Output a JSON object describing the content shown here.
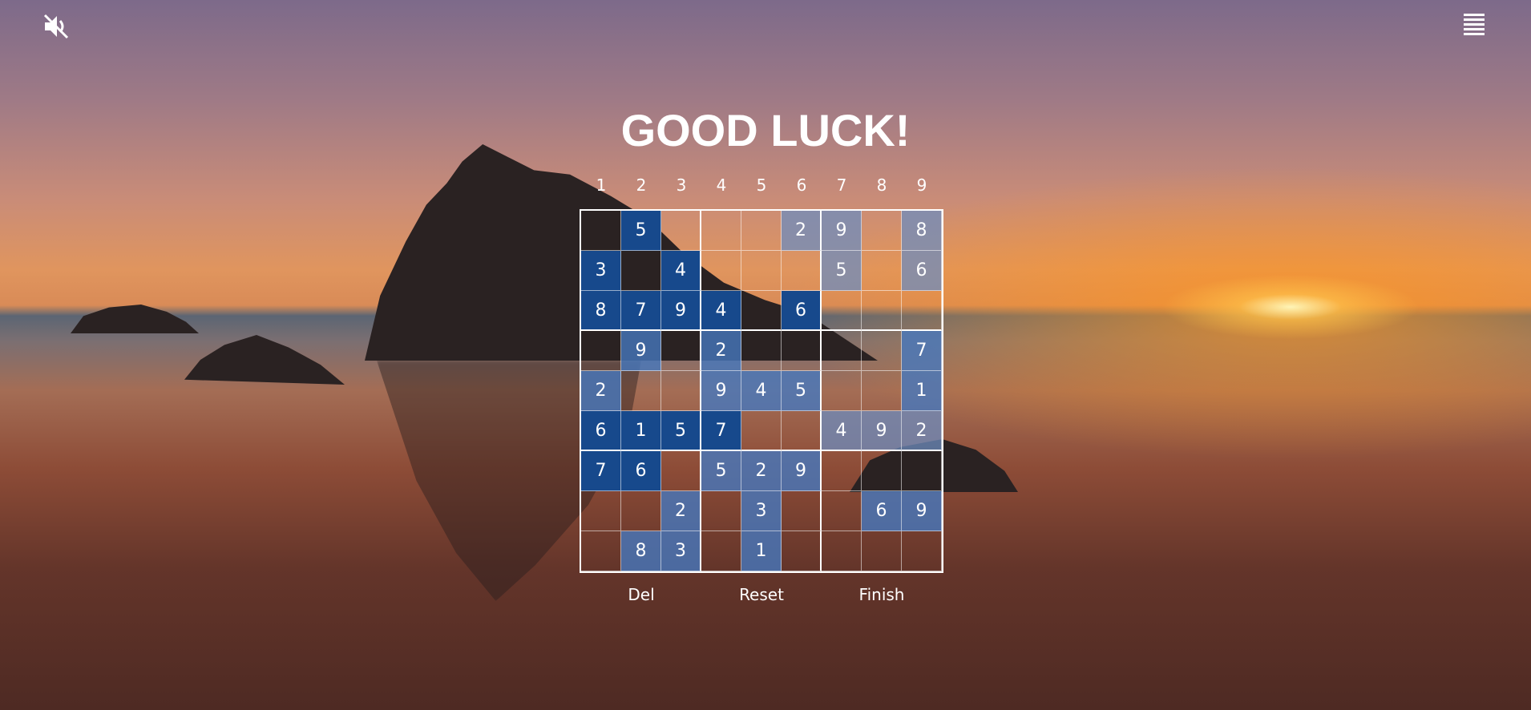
{
  "title": "GOOD LUCK!",
  "icons": {
    "mute": "mute-icon",
    "menu": "menu-icon"
  },
  "columns": [
    "1",
    "2",
    "3",
    "4",
    "5",
    "6",
    "7",
    "8",
    "9"
  ],
  "board": [
    [
      {
        "v": "",
        "t": "empty"
      },
      {
        "v": "5",
        "t": "given"
      },
      {
        "v": "",
        "t": "empty"
      },
      {
        "v": "",
        "t": "empty"
      },
      {
        "v": "",
        "t": "empty"
      },
      {
        "v": "2",
        "t": "faint"
      },
      {
        "v": "9",
        "t": "faint"
      },
      {
        "v": "",
        "t": "empty"
      },
      {
        "v": "8",
        "t": "faint"
      }
    ],
    [
      {
        "v": "3",
        "t": "given"
      },
      {
        "v": "",
        "t": "empty"
      },
      {
        "v": "4",
        "t": "given"
      },
      {
        "v": "",
        "t": "empty"
      },
      {
        "v": "",
        "t": "empty"
      },
      {
        "v": "",
        "t": "empty"
      },
      {
        "v": "5",
        "t": "faint"
      },
      {
        "v": "",
        "t": "empty"
      },
      {
        "v": "6",
        "t": "faint"
      }
    ],
    [
      {
        "v": "8",
        "t": "given"
      },
      {
        "v": "7",
        "t": "given"
      },
      {
        "v": "9",
        "t": "given"
      },
      {
        "v": "4",
        "t": "given"
      },
      {
        "v": "",
        "t": "empty"
      },
      {
        "v": "6",
        "t": "given"
      },
      {
        "v": "",
        "t": "empty"
      },
      {
        "v": "",
        "t": "empty"
      },
      {
        "v": "",
        "t": "empty"
      }
    ],
    [
      {
        "v": "",
        "t": "empty"
      },
      {
        "v": "9",
        "t": "user"
      },
      {
        "v": "",
        "t": "empty"
      },
      {
        "v": "2",
        "t": "user"
      },
      {
        "v": "",
        "t": "empty"
      },
      {
        "v": "",
        "t": "empty"
      },
      {
        "v": "",
        "t": "empty"
      },
      {
        "v": "",
        "t": "empty"
      },
      {
        "v": "7",
        "t": "user"
      }
    ],
    [
      {
        "v": "2",
        "t": "user"
      },
      {
        "v": "",
        "t": "empty"
      },
      {
        "v": "",
        "t": "empty"
      },
      {
        "v": "9",
        "t": "user"
      },
      {
        "v": "4",
        "t": "user"
      },
      {
        "v": "5",
        "t": "user"
      },
      {
        "v": "",
        "t": "empty"
      },
      {
        "v": "",
        "t": "empty"
      },
      {
        "v": "1",
        "t": "user"
      }
    ],
    [
      {
        "v": "6",
        "t": "given"
      },
      {
        "v": "1",
        "t": "given"
      },
      {
        "v": "5",
        "t": "given"
      },
      {
        "v": "7",
        "t": "given"
      },
      {
        "v": "",
        "t": "empty"
      },
      {
        "v": "",
        "t": "empty"
      },
      {
        "v": "4",
        "t": "faint"
      },
      {
        "v": "9",
        "t": "faint"
      },
      {
        "v": "2",
        "t": "faint"
      }
    ],
    [
      {
        "v": "7",
        "t": "given"
      },
      {
        "v": "6",
        "t": "given"
      },
      {
        "v": "",
        "t": "empty"
      },
      {
        "v": "5",
        "t": "user"
      },
      {
        "v": "2",
        "t": "user"
      },
      {
        "v": "9",
        "t": "user"
      },
      {
        "v": "",
        "t": "empty"
      },
      {
        "v": "",
        "t": "empty"
      },
      {
        "v": "",
        "t": "empty"
      }
    ],
    [
      {
        "v": "",
        "t": "empty"
      },
      {
        "v": "",
        "t": "empty"
      },
      {
        "v": "2",
        "t": "user"
      },
      {
        "v": "",
        "t": "empty"
      },
      {
        "v": "3",
        "t": "user"
      },
      {
        "v": "",
        "t": "empty"
      },
      {
        "v": "",
        "t": "empty"
      },
      {
        "v": "6",
        "t": "user"
      },
      {
        "v": "9",
        "t": "user"
      }
    ],
    [
      {
        "v": "",
        "t": "empty"
      },
      {
        "v": "8",
        "t": "user"
      },
      {
        "v": "3",
        "t": "user"
      },
      {
        "v": "",
        "t": "empty"
      },
      {
        "v": "1",
        "t": "user"
      },
      {
        "v": "",
        "t": "empty"
      },
      {
        "v": "",
        "t": "empty"
      },
      {
        "v": "",
        "t": "empty"
      },
      {
        "v": "",
        "t": "empty"
      }
    ]
  ],
  "controls": {
    "del": "Del",
    "reset": "Reset",
    "finish": "Finish"
  }
}
